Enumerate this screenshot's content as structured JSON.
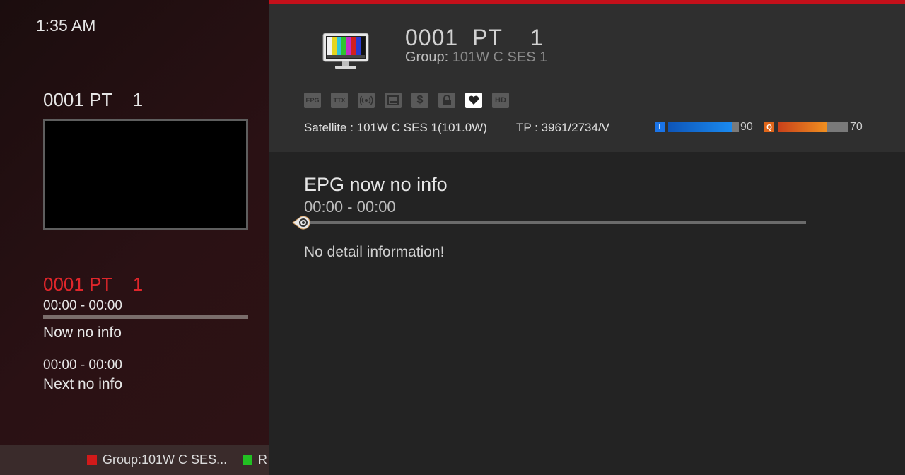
{
  "clock": "1:35 AM",
  "left": {
    "channel": "0001 PT    1",
    "channel_highlight": "0001 PT    1",
    "now_time": "00:00 - 00:00",
    "now_info": "Now no info",
    "next_time": "00:00 - 00:00",
    "next_info": "Next no info"
  },
  "bottom": {
    "red_label": "Group:101W C SES...",
    "green_label": "R",
    "red_color": "#d11a1a",
    "green_color": "#22c022"
  },
  "header": {
    "channel": "0001  PT    1",
    "group_label": "Group:",
    "group_value": "101W C SES 1",
    "satellite": "Satellite : 101W C SES 1(101.0W)",
    "tp": "TP : 3961/2734/V",
    "icons": [
      "epg-icon",
      "ttx-icon",
      "broadcast-icon",
      "subtitle-icon",
      "dollar-icon",
      "lock-icon",
      "favorite-heart-icon",
      "hd-icon"
    ],
    "icon_labels": {
      "epg": "EPG",
      "ttx": "TTX",
      "hd": "HD"
    },
    "signal": {
      "intensity_badge": "I",
      "intensity": 90,
      "intensity_color": "#1a74e8",
      "quality_badge": "Q",
      "quality": 70,
      "quality_color": "#e0661a"
    }
  },
  "epg": {
    "title": "EPG now no info",
    "time": "00:00 - 00:00",
    "progress": 0,
    "detail": "No detail information!"
  },
  "colors": {
    "accent_red": "#c4101a",
    "highlight_red": "#e0262b"
  }
}
